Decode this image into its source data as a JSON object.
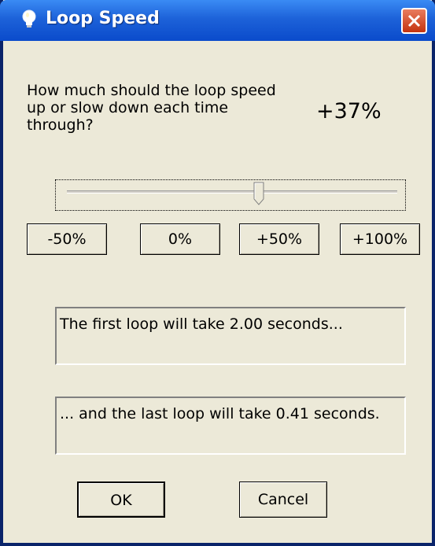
{
  "window": {
    "title": "Loop Speed"
  },
  "question": "How much should the loop speed up or slow down each time through?",
  "speed_value": "+37%",
  "slider": {
    "min_percent": -50,
    "max_percent": 100,
    "value_percent": 37
  },
  "presets": [
    "-50%",
    "0%",
    "+50%",
    "+100%"
  ],
  "info": {
    "first_loop": "The first loop will take 2.00 seconds...",
    "last_loop": "... and the last loop will take 0.41 seconds."
  },
  "buttons": {
    "ok": "OK",
    "cancel": "Cancel"
  },
  "icons": {
    "title": "lightbulb-icon",
    "close": "close-icon"
  },
  "colors": {
    "titlebar": "#0A4BCB",
    "close": "#C4330F",
    "background": "#ECE9D8"
  }
}
